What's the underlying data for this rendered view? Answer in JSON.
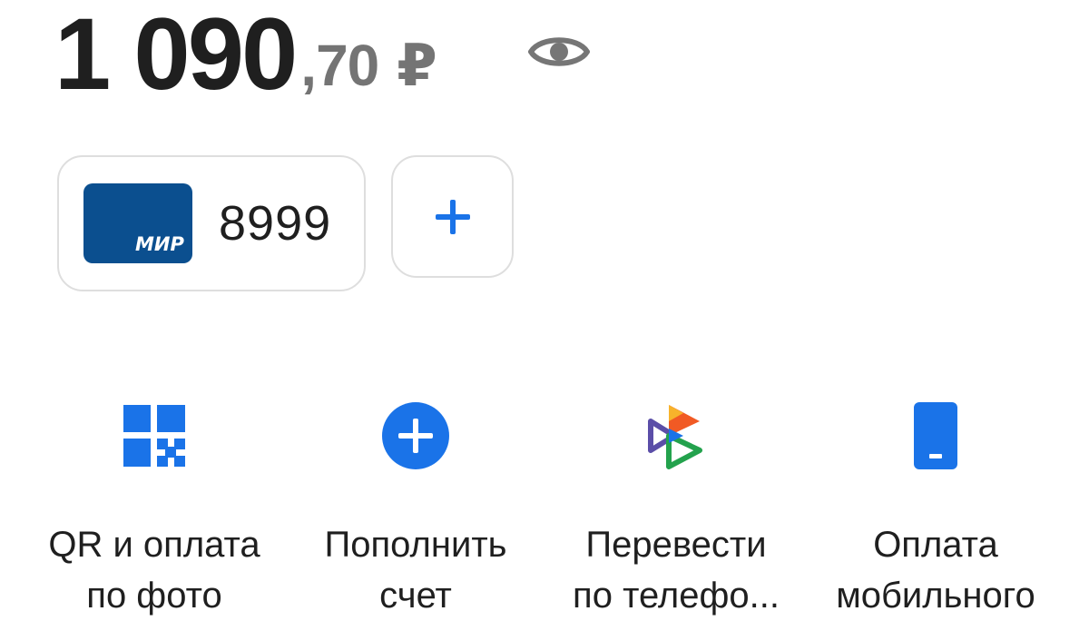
{
  "balance": {
    "integer": "1 090",
    "fraction": ",70",
    "currency": "₽"
  },
  "icons": {
    "visibility": "eye-icon",
    "card_brand": "mir-icon",
    "add": "plus-icon"
  },
  "cards": [
    {
      "brand": "МИР",
      "last4": "8999"
    }
  ],
  "colors": {
    "accent": "#1a73e8",
    "card": "#0b4f8f",
    "text": "#1f1f1f",
    "muted": "#747474",
    "border": "#dedede"
  },
  "actions": [
    {
      "line1": "QR и оплата",
      "line2": "по фото",
      "icon": "qr-icon"
    },
    {
      "line1": "Пополнить",
      "line2": "счет",
      "icon": "plus-circle-icon"
    },
    {
      "line1": "Перевести",
      "line2": "по телефо...",
      "icon": "sbp-icon"
    },
    {
      "line1": "Оплата",
      "line2": "мобильного",
      "icon": "phone-icon"
    }
  ]
}
